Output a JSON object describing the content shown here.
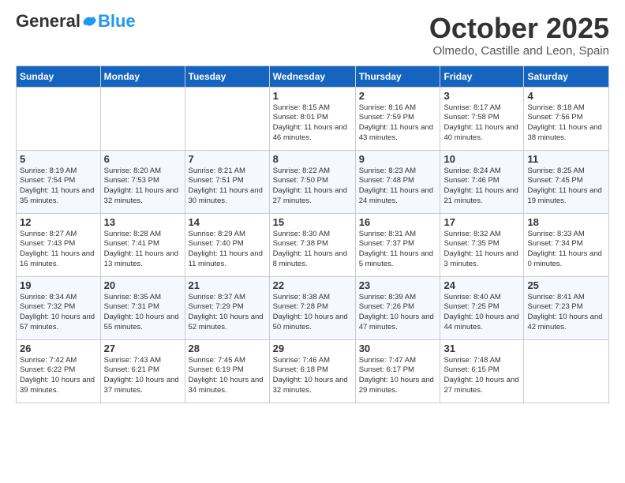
{
  "logo": {
    "general": "General",
    "blue": "Blue"
  },
  "title": "October 2025",
  "location": "Olmedo, Castille and Leon, Spain",
  "weekdays": [
    "Sunday",
    "Monday",
    "Tuesday",
    "Wednesday",
    "Thursday",
    "Friday",
    "Saturday"
  ],
  "weeks": [
    [
      {
        "day": "",
        "info": ""
      },
      {
        "day": "",
        "info": ""
      },
      {
        "day": "",
        "info": ""
      },
      {
        "day": "1",
        "info": "Sunrise: 8:15 AM\nSunset: 8:01 PM\nDaylight: 11 hours\nand 46 minutes."
      },
      {
        "day": "2",
        "info": "Sunrise: 8:16 AM\nSunset: 7:59 PM\nDaylight: 11 hours\nand 43 minutes."
      },
      {
        "day": "3",
        "info": "Sunrise: 8:17 AM\nSunset: 7:58 PM\nDaylight: 11 hours\nand 40 minutes."
      },
      {
        "day": "4",
        "info": "Sunrise: 8:18 AM\nSunset: 7:56 PM\nDaylight: 11 hours\nand 38 minutes."
      }
    ],
    [
      {
        "day": "5",
        "info": "Sunrise: 8:19 AM\nSunset: 7:54 PM\nDaylight: 11 hours\nand 35 minutes."
      },
      {
        "day": "6",
        "info": "Sunrise: 8:20 AM\nSunset: 7:53 PM\nDaylight: 11 hours\nand 32 minutes."
      },
      {
        "day": "7",
        "info": "Sunrise: 8:21 AM\nSunset: 7:51 PM\nDaylight: 11 hours\nand 30 minutes."
      },
      {
        "day": "8",
        "info": "Sunrise: 8:22 AM\nSunset: 7:50 PM\nDaylight: 11 hours\nand 27 minutes."
      },
      {
        "day": "9",
        "info": "Sunrise: 8:23 AM\nSunset: 7:48 PM\nDaylight: 11 hours\nand 24 minutes."
      },
      {
        "day": "10",
        "info": "Sunrise: 8:24 AM\nSunset: 7:46 PM\nDaylight: 11 hours\nand 21 minutes."
      },
      {
        "day": "11",
        "info": "Sunrise: 8:25 AM\nSunset: 7:45 PM\nDaylight: 11 hours\nand 19 minutes."
      }
    ],
    [
      {
        "day": "12",
        "info": "Sunrise: 8:27 AM\nSunset: 7:43 PM\nDaylight: 11 hours\nand 16 minutes."
      },
      {
        "day": "13",
        "info": "Sunrise: 8:28 AM\nSunset: 7:41 PM\nDaylight: 11 hours\nand 13 minutes."
      },
      {
        "day": "14",
        "info": "Sunrise: 8:29 AM\nSunset: 7:40 PM\nDaylight: 11 hours\nand 11 minutes."
      },
      {
        "day": "15",
        "info": "Sunrise: 8:30 AM\nSunset: 7:38 PM\nDaylight: 11 hours\nand 8 minutes."
      },
      {
        "day": "16",
        "info": "Sunrise: 8:31 AM\nSunset: 7:37 PM\nDaylight: 11 hours\nand 5 minutes."
      },
      {
        "day": "17",
        "info": "Sunrise: 8:32 AM\nSunset: 7:35 PM\nDaylight: 11 hours\nand 3 minutes."
      },
      {
        "day": "18",
        "info": "Sunrise: 8:33 AM\nSunset: 7:34 PM\nDaylight: 11 hours\nand 0 minutes."
      }
    ],
    [
      {
        "day": "19",
        "info": "Sunrise: 8:34 AM\nSunset: 7:32 PM\nDaylight: 10 hours\nand 57 minutes."
      },
      {
        "day": "20",
        "info": "Sunrise: 8:35 AM\nSunset: 7:31 PM\nDaylight: 10 hours\nand 55 minutes."
      },
      {
        "day": "21",
        "info": "Sunrise: 8:37 AM\nSunset: 7:29 PM\nDaylight: 10 hours\nand 52 minutes."
      },
      {
        "day": "22",
        "info": "Sunrise: 8:38 AM\nSunset: 7:28 PM\nDaylight: 10 hours\nand 50 minutes."
      },
      {
        "day": "23",
        "info": "Sunrise: 8:39 AM\nSunset: 7:26 PM\nDaylight: 10 hours\nand 47 minutes."
      },
      {
        "day": "24",
        "info": "Sunrise: 8:40 AM\nSunset: 7:25 PM\nDaylight: 10 hours\nand 44 minutes."
      },
      {
        "day": "25",
        "info": "Sunrise: 8:41 AM\nSunset: 7:23 PM\nDaylight: 10 hours\nand 42 minutes."
      }
    ],
    [
      {
        "day": "26",
        "info": "Sunrise: 7:42 AM\nSunset: 6:22 PM\nDaylight: 10 hours\nand 39 minutes."
      },
      {
        "day": "27",
        "info": "Sunrise: 7:43 AM\nSunset: 6:21 PM\nDaylight: 10 hours\nand 37 minutes."
      },
      {
        "day": "28",
        "info": "Sunrise: 7:45 AM\nSunset: 6:19 PM\nDaylight: 10 hours\nand 34 minutes."
      },
      {
        "day": "29",
        "info": "Sunrise: 7:46 AM\nSunset: 6:18 PM\nDaylight: 10 hours\nand 32 minutes."
      },
      {
        "day": "30",
        "info": "Sunrise: 7:47 AM\nSunset: 6:17 PM\nDaylight: 10 hours\nand 29 minutes."
      },
      {
        "day": "31",
        "info": "Sunrise: 7:48 AM\nSunset: 6:15 PM\nDaylight: 10 hours\nand 27 minutes."
      },
      {
        "day": "",
        "info": ""
      }
    ]
  ]
}
